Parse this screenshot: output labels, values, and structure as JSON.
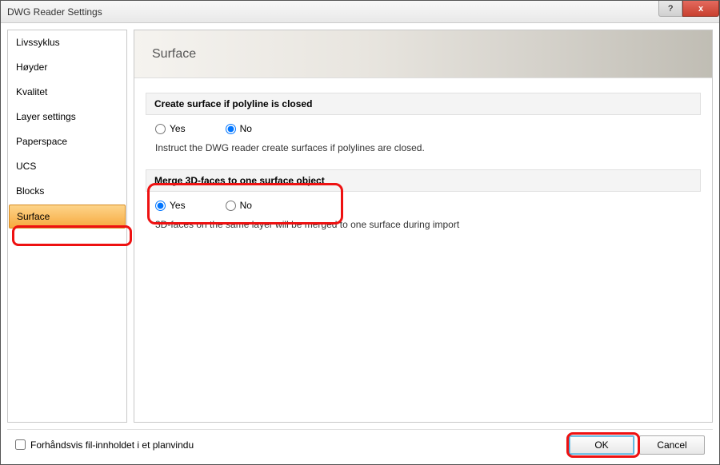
{
  "window": {
    "title": "DWG Reader Settings"
  },
  "sidebar": {
    "items": [
      {
        "label": "Livssyklus"
      },
      {
        "label": "Høyder"
      },
      {
        "label": "Kvalitet"
      },
      {
        "label": "Layer settings"
      },
      {
        "label": "Paperspace"
      },
      {
        "label": "UCS"
      },
      {
        "label": "Blocks"
      },
      {
        "label": "Surface"
      }
    ],
    "selected": "Surface"
  },
  "content": {
    "title": "Surface",
    "sections": [
      {
        "title": "Create surface if polyline is closed",
        "options": {
          "yes": "Yes",
          "no": "No"
        },
        "selected": "No",
        "description": "Instruct the DWG reader create surfaces if polylines are closed."
      },
      {
        "title": "Merge 3D-faces to one surface object",
        "options": {
          "yes": "Yes",
          "no": "No"
        },
        "selected": "Yes",
        "description": "3D-faces on the same layer will be merged to one surface during import"
      }
    ]
  },
  "footer": {
    "preview_label": "Forhåndsvis fil-innholdet i et planvindu",
    "preview_checked": false,
    "ok_label": "OK",
    "cancel_label": "Cancel"
  },
  "titlebar_controls": {
    "help": "?",
    "close": "x"
  }
}
